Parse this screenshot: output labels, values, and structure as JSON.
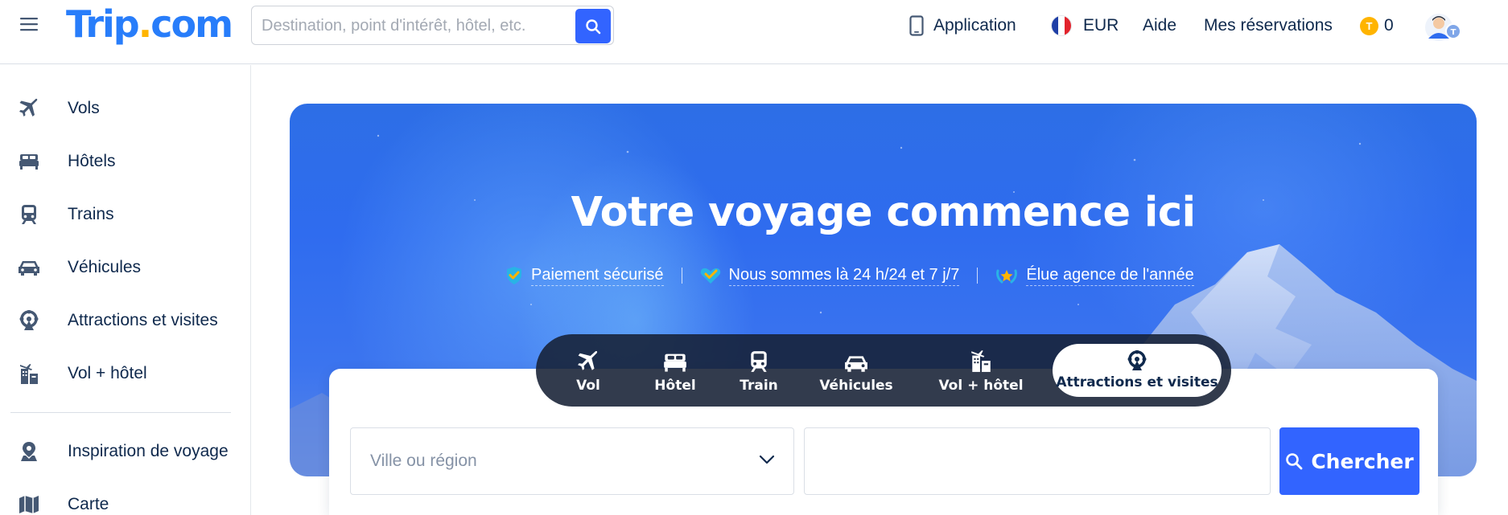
{
  "header": {
    "logo": {
      "main": "Trip",
      "dot": ".",
      "suffix": "com"
    },
    "search": {
      "placeholder": "Destination, point d'intérêt, hôtel, etc."
    },
    "nav": {
      "app": "Application",
      "currency": "EUR",
      "help": "Aide",
      "bookings": "Mes réservations",
      "coins": "0",
      "coin_glyph": "T"
    },
    "colors": {
      "brand": "#287dfa",
      "accent": "#ffb400",
      "primary_button": "#3264ff"
    }
  },
  "sidebar": {
    "items": [
      {
        "label": "Vols",
        "icon": "plane-icon"
      },
      {
        "label": "Hôtels",
        "icon": "bed-icon"
      },
      {
        "label": "Trains",
        "icon": "train-icon"
      },
      {
        "label": "Véhicules",
        "icon": "car-icon"
      },
      {
        "label": "Attractions et visites",
        "icon": "ferris-wheel-icon"
      },
      {
        "label": "Vol + hôtel",
        "icon": "flight-hotel-icon"
      },
      {
        "label": "Inspiration de voyage",
        "icon": "map-pin-icon"
      },
      {
        "label": "Carte",
        "icon": "map-icon"
      }
    ]
  },
  "hero": {
    "title": "Votre voyage commence ici",
    "features": [
      {
        "label": "Paiement sécurisé",
        "icon": "shield-check-icon"
      },
      {
        "label": "Nous sommes là 24 h/24 et 7 j/7",
        "icon": "heart-check-icon"
      },
      {
        "label": "Élue agence de l'année",
        "icon": "award-icon"
      }
    ]
  },
  "product_tabs": {
    "items": [
      {
        "label": "Vol",
        "icon": "plane-icon"
      },
      {
        "label": "Hôtel",
        "icon": "bed-icon"
      },
      {
        "label": "Train",
        "icon": "train-icon"
      },
      {
        "label": "Véhicules",
        "icon": "car-icon"
      },
      {
        "label": "Vol + hôtel",
        "icon": "flight-hotel-icon"
      },
      {
        "label": "Attractions et visites",
        "icon": "ferris-wheel-icon"
      }
    ],
    "active": "Attractions et visites"
  },
  "search_card": {
    "city_placeholder": "Ville ou région",
    "date_value": "",
    "search_button": "Chercher"
  }
}
